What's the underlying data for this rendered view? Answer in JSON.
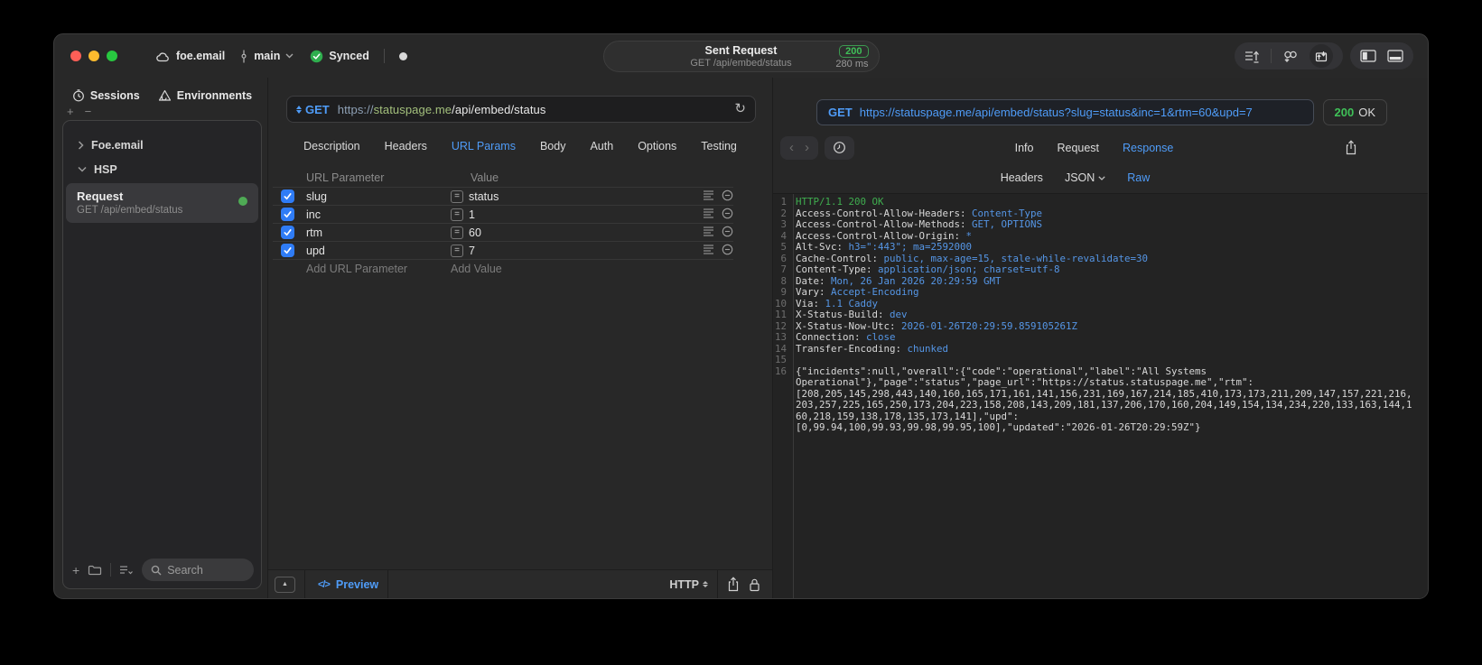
{
  "colors": {
    "accent_blue": "#4f9cf8",
    "status_green": "#3fc158",
    "checkbox_blue": "#2f7cf6",
    "value_blue": "#5596e6"
  },
  "icons": {
    "plus": "+",
    "minus": "−",
    "collapse": "▲",
    "code": "</>",
    "equals": "=",
    "chevron_back": "‹",
    "chevron_forward": "›",
    "refresh": "↻"
  },
  "titlebar": {
    "project": "foe.email",
    "branch": "main",
    "sync_status": "Synced",
    "center": {
      "title": "Sent Request",
      "subtitle": "GET /api/embed/status",
      "status_code": "200",
      "duration": "280 ms"
    }
  },
  "sidebar": {
    "tabs": [
      {
        "label": "Sessions"
      },
      {
        "label": "Environments"
      }
    ],
    "tree": [
      {
        "label": "Foe.email",
        "state": "collapsed"
      },
      {
        "label": "HSP",
        "state": "expanded"
      }
    ],
    "selected_request": {
      "title": "Request",
      "subtitle": "GET /api/embed/status"
    },
    "search_placeholder": "Search"
  },
  "request_pane": {
    "method": "GET",
    "url_scheme": "https://",
    "url_host": "statuspage.me",
    "url_path": "/api/embed/status",
    "tabs": [
      "Description",
      "Headers",
      "URL Params",
      "Body",
      "Auth",
      "Options",
      "Testing"
    ],
    "active_tab": "URL Params",
    "params_table": {
      "columns": [
        "URL Parameter",
        "Value"
      ],
      "rows": [
        {
          "checked": true,
          "name": "slug",
          "value": "status"
        },
        {
          "checked": true,
          "name": "inc",
          "value": "1"
        },
        {
          "checked": true,
          "name": "rtm",
          "value": "60"
        },
        {
          "checked": true,
          "name": "upd",
          "value": "7"
        }
      ],
      "add_name_placeholder": "Add URL Parameter",
      "add_value_placeholder": "Add Value"
    },
    "footer": {
      "preview_label": "Preview",
      "protocol": "HTTP"
    }
  },
  "response_pane": {
    "method": "GET",
    "url": "https://statuspage.me/api/embed/status?slug=status&inc=1&rtm=60&upd=7",
    "status_code": "200",
    "status_text": "OK",
    "tabs": [
      "Info",
      "Request",
      "Response"
    ],
    "active_tab": "Response",
    "subtabs": [
      "Headers",
      "JSON",
      "Raw"
    ],
    "active_subtab": "Raw",
    "body_lines": [
      {
        "n": "1",
        "segs": [
          {
            "t": "HTTP/1.1 200 OK",
            "c": "g"
          }
        ]
      },
      {
        "n": "2",
        "segs": [
          {
            "t": "Access-Control-Allow-Headers: ",
            "c": "k"
          },
          {
            "t": "Content-Type",
            "c": "v"
          }
        ]
      },
      {
        "n": "3",
        "segs": [
          {
            "t": "Access-Control-Allow-Methods: ",
            "c": "k"
          },
          {
            "t": "GET, OPTIONS",
            "c": "v"
          }
        ]
      },
      {
        "n": "4",
        "segs": [
          {
            "t": "Access-Control-Allow-Origin: ",
            "c": "k"
          },
          {
            "t": "*",
            "c": "v"
          }
        ]
      },
      {
        "n": "5",
        "segs": [
          {
            "t": "Alt-Svc: ",
            "c": "k"
          },
          {
            "t": "h3=\":443\"; ma=2592000",
            "c": "v"
          }
        ]
      },
      {
        "n": "6",
        "segs": [
          {
            "t": "Cache-Control: ",
            "c": "k"
          },
          {
            "t": "public, max-age=15, stale-while-revalidate=30",
            "c": "v"
          }
        ]
      },
      {
        "n": "7",
        "segs": [
          {
            "t": "Content-Type: ",
            "c": "k"
          },
          {
            "t": "application/json; charset=utf-8",
            "c": "v"
          }
        ]
      },
      {
        "n": "8",
        "segs": [
          {
            "t": "Date: ",
            "c": "k"
          },
          {
            "t": "Mon, 26 Jan 2026 20:29:59 GMT",
            "c": "v"
          }
        ]
      },
      {
        "n": "9",
        "segs": [
          {
            "t": "Vary: ",
            "c": "k"
          },
          {
            "t": "Accept-Encoding",
            "c": "v"
          }
        ]
      },
      {
        "n": "10",
        "segs": [
          {
            "t": "Via: ",
            "c": "k"
          },
          {
            "t": "1.1 Caddy",
            "c": "v"
          }
        ]
      },
      {
        "n": "11",
        "segs": [
          {
            "t": "X-Status-Build: ",
            "c": "k"
          },
          {
            "t": "dev",
            "c": "v"
          }
        ]
      },
      {
        "n": "12",
        "segs": [
          {
            "t": "X-Status-Now-Utc: ",
            "c": "k"
          },
          {
            "t": "2026-01-26T20:29:59.859105261Z",
            "c": "v"
          }
        ]
      },
      {
        "n": "13",
        "segs": [
          {
            "t": "Connection: ",
            "c": "k"
          },
          {
            "t": "close",
            "c": "v"
          }
        ]
      },
      {
        "n": "14",
        "segs": [
          {
            "t": "Transfer-Encoding: ",
            "c": "k"
          },
          {
            "t": "chunked",
            "c": "v"
          }
        ]
      },
      {
        "n": "15",
        "segs": []
      },
      {
        "n": "16",
        "segs": [
          {
            "t": "{\"incidents\":null,\"overall\":{\"code\":\"operational\",\"label\":\"All Systems",
            "c": "k"
          }
        ]
      },
      {
        "n": "",
        "segs": [
          {
            "t": "Operational\"},\"page\":\"status\",\"page_url\":\"https://status.statuspage.me\",\"rtm\":",
            "c": "k"
          }
        ]
      },
      {
        "n": "",
        "segs": [
          {
            "t": "[208,205,145,298,443,140,160,165,171,161,141,156,231,169,167,214,185,410,173,173,211,209,147,157,221,216,",
            "c": "k"
          }
        ]
      },
      {
        "n": "",
        "segs": [
          {
            "t": "203,257,225,165,250,173,204,223,158,208,143,209,181,137,206,170,160,204,149,154,134,234,220,133,163,144,1",
            "c": "k"
          }
        ]
      },
      {
        "n": "",
        "segs": [
          {
            "t": "60,218,159,138,178,135,173,141],\"upd\":",
            "c": "k"
          }
        ]
      },
      {
        "n": "",
        "segs": [
          {
            "t": "[0,99.94,100,99.93,99.98,99.95,100],\"updated\":\"2026-01-26T20:29:59Z\"}",
            "c": "k"
          }
        ]
      }
    ]
  }
}
